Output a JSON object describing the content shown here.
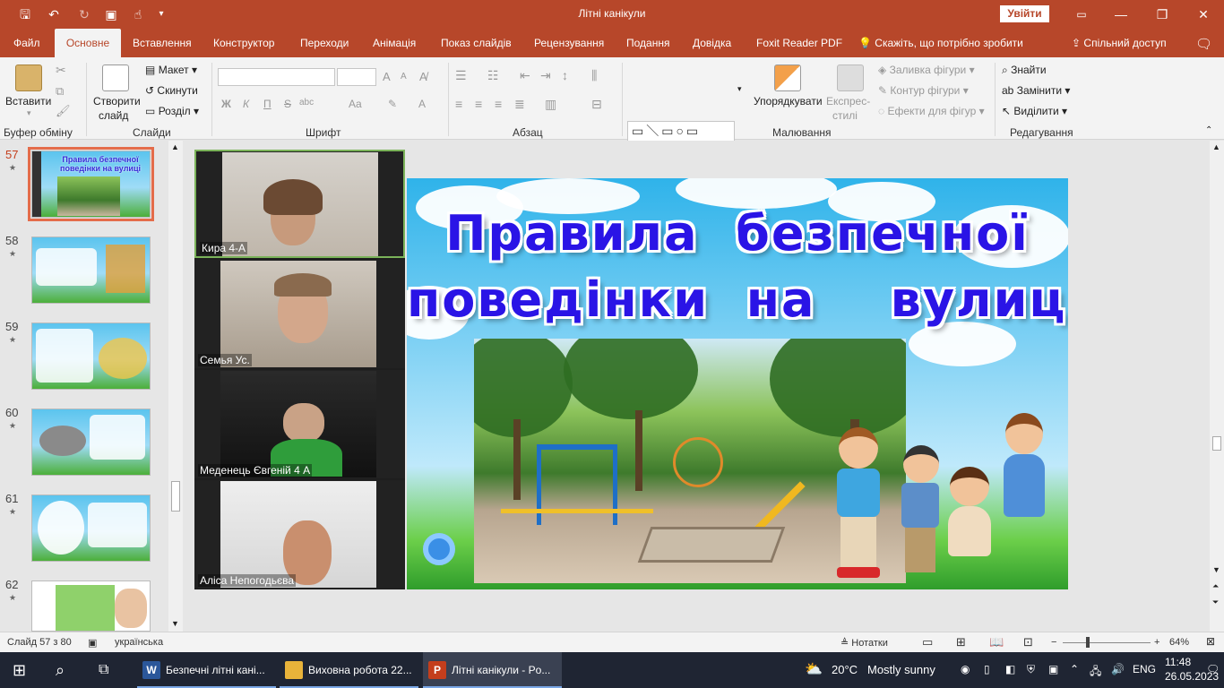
{
  "window": {
    "title": "Літні канікули",
    "signin_label": "Увійти",
    "minimize": "—",
    "restore": "❐",
    "close": "✕"
  },
  "tabs": [
    {
      "label": "Файл"
    },
    {
      "label": "Основне"
    },
    {
      "label": "Вставлення"
    },
    {
      "label": "Конструктор"
    },
    {
      "label": "Переходи"
    },
    {
      "label": "Анімація"
    },
    {
      "label": "Показ слайдів"
    },
    {
      "label": "Рецензування"
    },
    {
      "label": "Подання"
    },
    {
      "label": "Довідка"
    },
    {
      "label": "Foxit Reader PDF"
    }
  ],
  "tellme": "Скажіть, що потрібно зробити",
  "share": "Спільний доступ",
  "ribbon": {
    "clipboard": {
      "label": "Буфер обміну",
      "paste": "Вставити"
    },
    "slides": {
      "label": "Слайди",
      "new_slide_1": "Створити",
      "new_slide_2": "слайд",
      "layout": "Макет",
      "reset": "Скинути",
      "section": "Розділ"
    },
    "font": {
      "label": "Шрифт",
      "bold": "Ж",
      "italic": "К",
      "underline": "П",
      "strike": "S",
      "spacing": "abc",
      "case": "Aa",
      "size_up": "A",
      "size_down": "A",
      "color": "A"
    },
    "paragraph": {
      "label": "Абзац"
    },
    "drawing": {
      "label": "Малювання",
      "arrange": "Упорядкувати",
      "quick_styles_1": "Експрес-",
      "quick_styles_2": "стилі",
      "fill": "Заливка фігури",
      "outline": "Контур фігури",
      "effects": "Ефекти для фігур"
    },
    "editing": {
      "label": "Редагування",
      "find": "Знайти",
      "replace": "Замінити",
      "select": "Виділити"
    }
  },
  "thumbnails": [
    {
      "num": "57",
      "title": "Правила безпечної поведінки на вулиці"
    },
    {
      "num": "58"
    },
    {
      "num": "59"
    },
    {
      "num": "60"
    },
    {
      "num": "61"
    },
    {
      "num": "62"
    }
  ],
  "video": [
    {
      "name": "Кира 4-А"
    },
    {
      "name": "Семья Ус."
    },
    {
      "name": "Меденець Євгеній 4 А"
    },
    {
      "name": "Аліса Непогодьєва"
    }
  ],
  "slide": {
    "title_line1": "Правила  безпечної",
    "title_line2": "поведінки  на    вулиці"
  },
  "status": {
    "slide_count": "Слайд 57 з 80",
    "language": "українська",
    "notes": "Нотатки",
    "zoom": "64%"
  },
  "taskbar": {
    "apps": [
      {
        "icon": "W",
        "label": "Безпечні літні кані...",
        "color": "#2b579a"
      },
      {
        "icon": "",
        "label": "Виховна робота 22...",
        "color": "#e8b33a"
      },
      {
        "icon": "P",
        "label": "Літні канікули - Po...",
        "color": "#c43e1c"
      }
    ],
    "weather_temp": "20°C",
    "weather_text": "Mostly sunny",
    "lang": "ENG",
    "time": "11:48",
    "date": "26.05.2023"
  },
  "colors": {
    "accent": "#b7472a",
    "title_blue": "#2a14e6",
    "selected_thumb": "#e46c4a"
  }
}
